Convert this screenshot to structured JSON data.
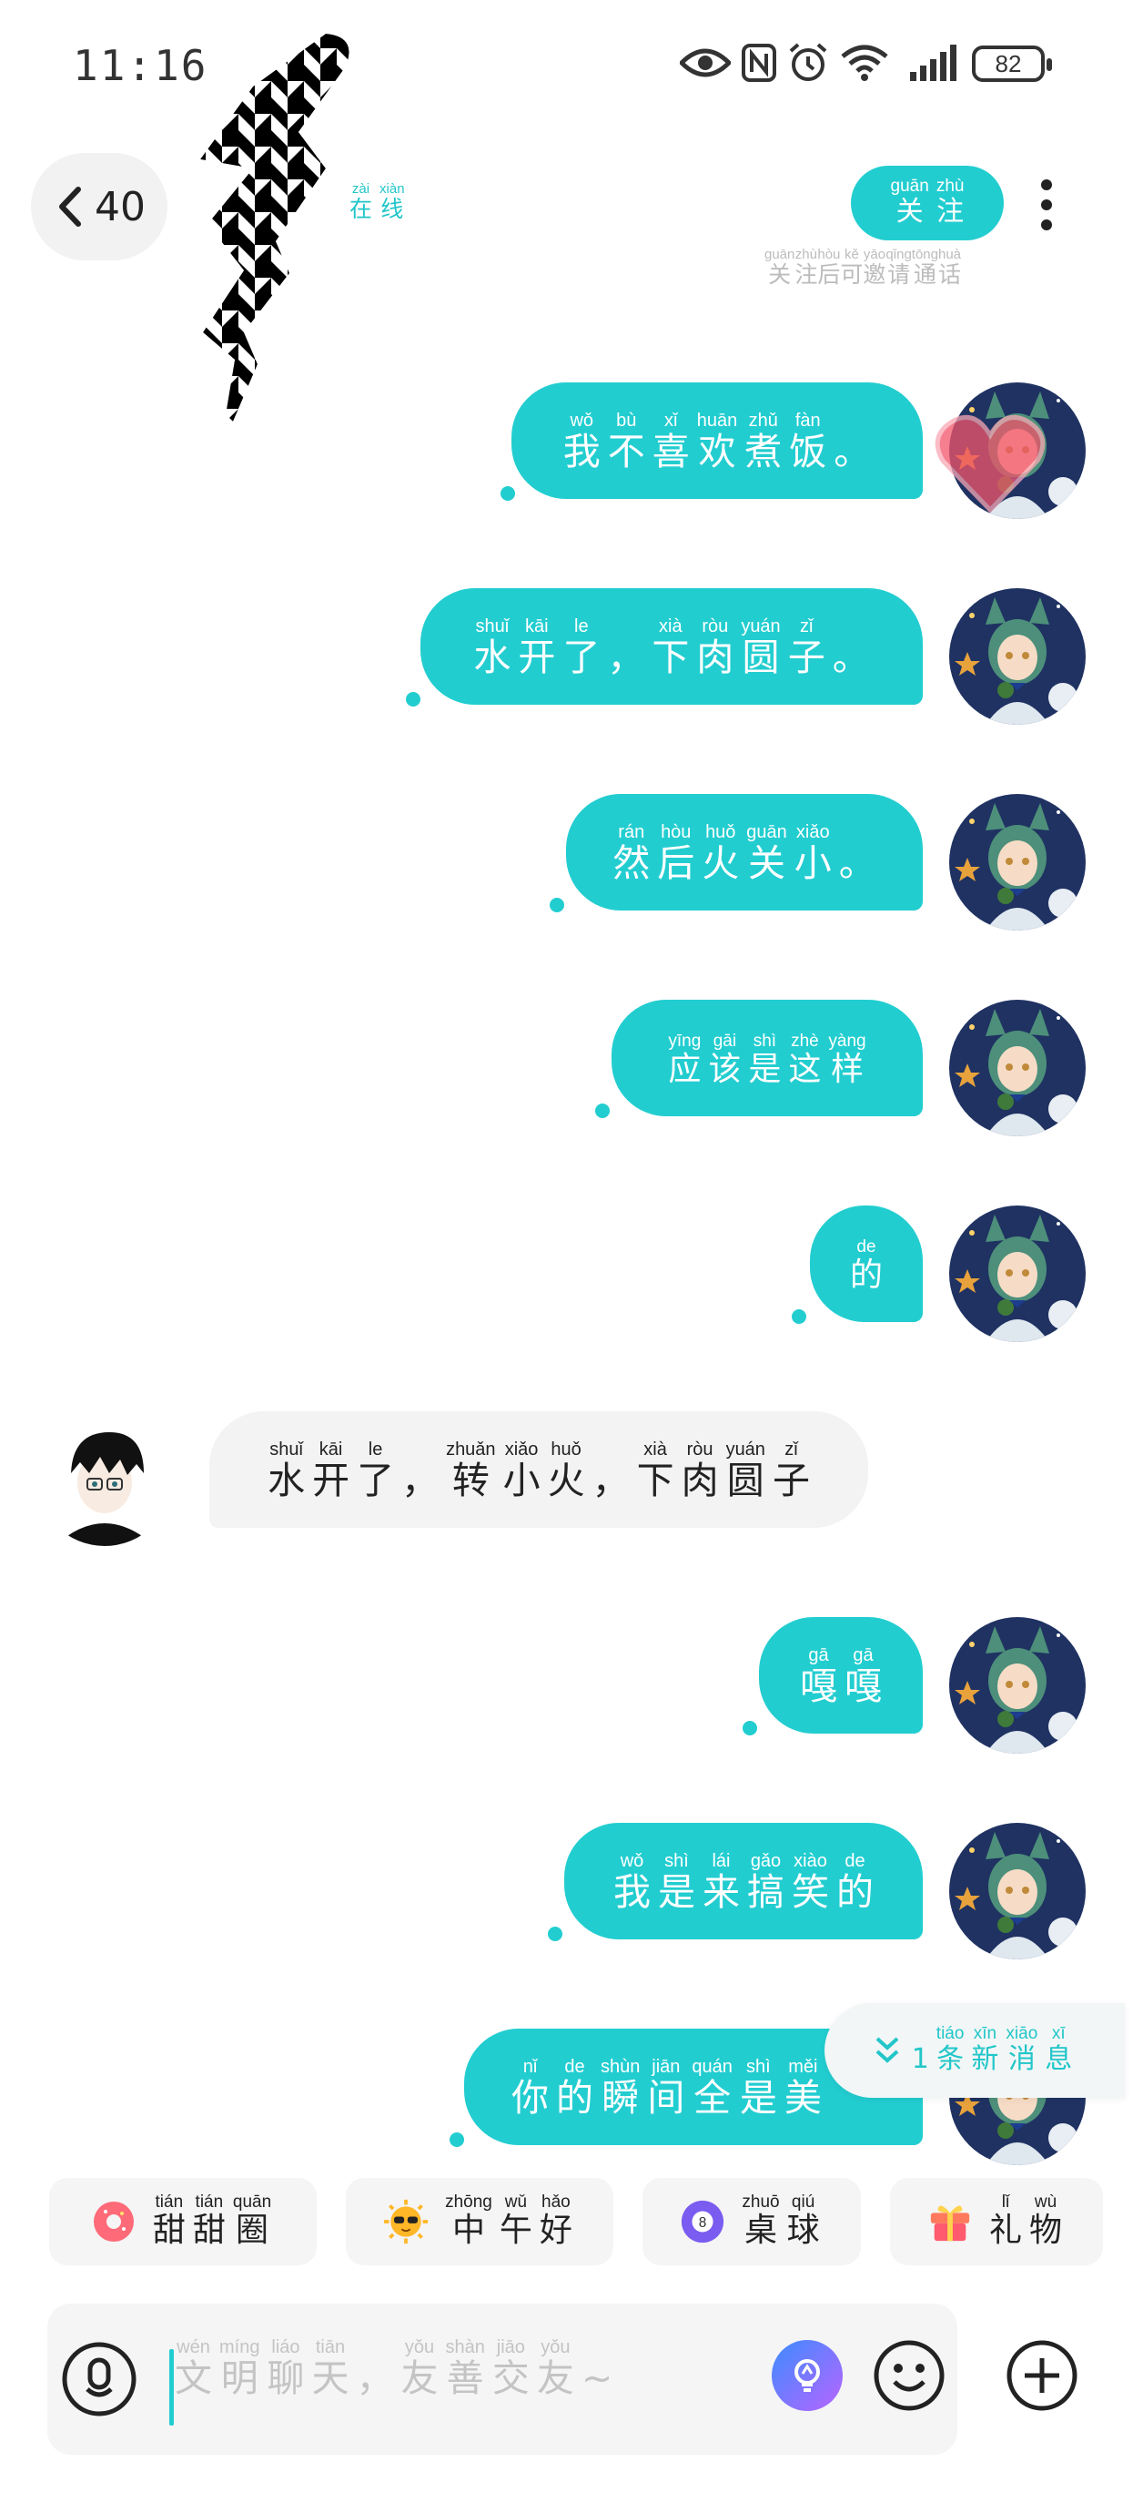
{
  "status_bar": {
    "time": "11:16",
    "battery": "82"
  },
  "header": {
    "back_count": "40",
    "online": [
      [
        "在",
        "zài"
      ],
      [
        "线",
        "xiàn"
      ]
    ],
    "follow": [
      [
        "关",
        "guān"
      ],
      [
        "注",
        "zhù"
      ]
    ],
    "follow_hint": [
      [
        "关",
        "guān"
      ],
      [
        "注",
        "zhù"
      ],
      [
        "后",
        "hòu"
      ],
      [
        "可",
        "kě"
      ],
      [
        "邀",
        "yāo"
      ],
      [
        "请",
        "qǐng"
      ],
      [
        "通",
        "tōng"
      ],
      [
        "话",
        "huà"
      ]
    ]
  },
  "messages": [
    {
      "from": "me",
      "text": [
        [
          "我",
          "wǒ"
        ],
        [
          "不",
          "bù"
        ],
        [
          "喜",
          "xǐ"
        ],
        [
          "欢",
          "huān"
        ],
        [
          "煮",
          "zhǔ"
        ],
        [
          "饭",
          "fàn"
        ],
        [
          "。",
          ""
        ]
      ]
    },
    {
      "from": "me",
      "text": [
        [
          "水",
          "shuǐ"
        ],
        [
          "开",
          "kāi"
        ],
        [
          "了",
          "le"
        ],
        [
          "，",
          ""
        ],
        [
          "下",
          "xià"
        ],
        [
          "肉",
          "ròu"
        ],
        [
          "圆",
          "yuán"
        ],
        [
          "子",
          "zǐ"
        ],
        [
          "。",
          ""
        ]
      ]
    },
    {
      "from": "me",
      "text": [
        [
          "然",
          "rán"
        ],
        [
          "后",
          "hòu"
        ],
        [
          "火",
          "huǒ"
        ],
        [
          "关",
          "guān"
        ],
        [
          "小",
          "xiǎo"
        ],
        [
          "。",
          ""
        ]
      ]
    },
    {
      "from": "me",
      "text": [
        [
          "应",
          "yīng"
        ],
        [
          "该",
          "gāi"
        ],
        [
          "是",
          "shì"
        ],
        [
          "这",
          "zhè"
        ],
        [
          "样",
          "yàng"
        ]
      ]
    },
    {
      "from": "me",
      "text": [
        [
          "的",
          "de"
        ]
      ]
    },
    {
      "from": "other",
      "text": [
        [
          "水",
          "shuǐ"
        ],
        [
          "开",
          "kāi"
        ],
        [
          "了",
          "le"
        ],
        [
          "，",
          ""
        ],
        [
          "转",
          "zhuǎn"
        ],
        [
          "小",
          "xiǎo"
        ],
        [
          "火",
          "huǒ"
        ],
        [
          "，",
          ""
        ],
        [
          "下",
          "xià"
        ],
        [
          "肉",
          "ròu"
        ],
        [
          "圆",
          "yuán"
        ],
        [
          "子",
          "zǐ"
        ]
      ]
    },
    {
      "from": "me",
      "text": [
        [
          "嘎",
          "gā"
        ],
        [
          "嘎",
          "gā"
        ]
      ]
    },
    {
      "from": "me",
      "text": [
        [
          "我",
          "wǒ"
        ],
        [
          "是",
          "shì"
        ],
        [
          "来",
          "lái"
        ],
        [
          "搞",
          "gǎo"
        ],
        [
          "笑",
          "xiào"
        ],
        [
          "的",
          "de"
        ]
      ]
    },
    {
      "from": "me",
      "text": [
        [
          "你",
          "nǐ"
        ],
        [
          "的",
          "de"
        ],
        [
          "瞬",
          "shùn"
        ],
        [
          "间",
          "jiān"
        ],
        [
          "全",
          "quán"
        ],
        [
          "是",
          "shì"
        ],
        [
          "美",
          "měi"
        ]
      ]
    }
  ],
  "new_message_banner": [
    [
      "1",
      ""
    ],
    [
      "条",
      "tiáo"
    ],
    [
      "新",
      "xīn"
    ],
    [
      "消",
      "xiāo"
    ],
    [
      "息",
      "xī"
    ]
  ],
  "quick_replies": [
    {
      "icon": "donut-icon",
      "label": [
        [
          "甜",
          "tián"
        ],
        [
          "甜",
          "tián"
        ],
        [
          "圈",
          "quān"
        ]
      ]
    },
    {
      "icon": "sunglasses-sun-icon",
      "label": [
        [
          "中",
          "zhōng"
        ],
        [
          "午",
          "wǔ"
        ],
        [
          "好",
          "hǎo"
        ]
      ]
    },
    {
      "icon": "billiard-ball-icon",
      "label": [
        [
          "桌",
          "zhuō"
        ],
        [
          "球",
          "qiú"
        ]
      ]
    },
    {
      "icon": "gift-icon",
      "label": [
        [
          "礼",
          "lǐ"
        ],
        [
          "物",
          "wù"
        ]
      ]
    }
  ],
  "input": {
    "placeholder": [
      [
        "文",
        "wén"
      ],
      [
        "明",
        "míng"
      ],
      [
        "聊",
        "liáo"
      ],
      [
        "天",
        "tiān"
      ],
      [
        "，",
        ""
      ],
      [
        "友",
        "yǒu"
      ],
      [
        "善",
        "shàn"
      ],
      [
        "交",
        "jiāo"
      ],
      [
        "友",
        "yǒu"
      ],
      [
        "~",
        ""
      ]
    ]
  },
  "colors": {
    "accent": "#22cdd0",
    "other_bubble": "#f3f3f3",
    "hint": "#bcbcbc"
  }
}
